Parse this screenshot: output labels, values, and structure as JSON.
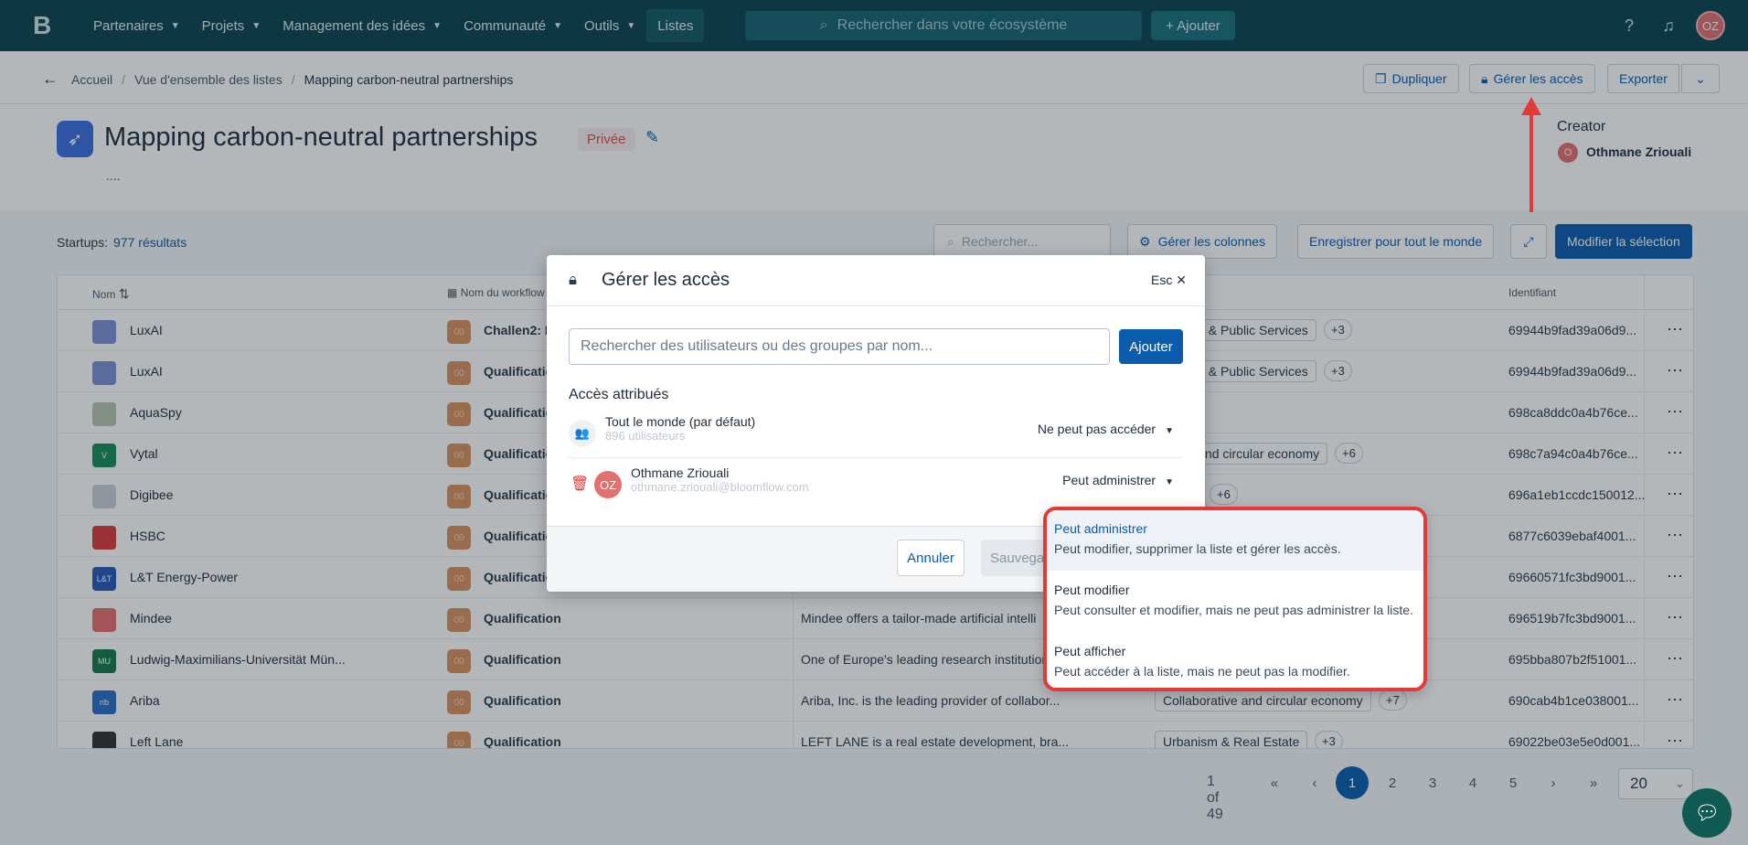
{
  "topnav": {
    "logo": "B",
    "items": [
      {
        "label": "Partenaires",
        "has_menu": true
      },
      {
        "label": "Projets",
        "has_menu": true
      },
      {
        "label": "Management des idées",
        "has_menu": true
      },
      {
        "label": "Communauté",
        "has_menu": true
      },
      {
        "label": "Outils",
        "has_menu": true
      },
      {
        "label": "Listes",
        "has_menu": false
      }
    ],
    "search_placeholder": "Rechercher dans votre écosystème",
    "add_label": "+ Ajouter",
    "avatar": "OZ"
  },
  "breadcrumb": {
    "items": [
      "Accueil",
      "Vue d'ensemble des listes",
      "Mapping carbon-neutral partnerships"
    ]
  },
  "header_actions": {
    "duplicate": "Dupliquer",
    "manage_access": "Gérer les accès",
    "export": "Exporter"
  },
  "page": {
    "title": "Mapping carbon-neutral partnerships",
    "visibility": "Privée",
    "description": "....",
    "creator_label": "Creator",
    "creator_avatar": "O",
    "creator_name": "Othmane Zriouali"
  },
  "toolbar": {
    "startups_label": "Startups:",
    "results": "977 résultats",
    "search_placeholder": "Rechercher...",
    "manage_columns": "Gérer les colonnes",
    "save_for_all": "Enregistrer pour tout le monde",
    "modify_selection": "Modifier la sélection"
  },
  "table": {
    "columns": {
      "name": "Nom",
      "workflow": "Nom du workflow",
      "identifier": "Identifiant"
    },
    "rows": [
      {
        "name": "LuxAI",
        "workflow": "Challen2: P",
        "desc": "",
        "tag": "stration & Public Services",
        "more": "+3",
        "id": "69944b9fad39a06d9...",
        "logo": "",
        "color": "#7c8fd6"
      },
      {
        "name": "LuxAI",
        "workflow": "Qualification",
        "desc": "",
        "tag": "stration & Public Services",
        "more": "+3",
        "id": "69944b9fad39a06d9...",
        "logo": "",
        "color": "#7c8fd6"
      },
      {
        "name": "AquaSpy",
        "workflow": "Qualification",
        "desc": "",
        "tag": "",
        "more": "",
        "id": "698ca8ddc0a4b76ce...",
        "logo": "",
        "color": "#b8c3b0"
      },
      {
        "name": "Vytal",
        "workflow": "Qualification",
        "desc": "",
        "tag": "rative and circular economy",
        "more": "+6",
        "id": "698c7a94c0a4b76ce...",
        "logo": "V",
        "color": "#1b8c5a"
      },
      {
        "name": "Digibee",
        "workflow": "Qualification",
        "desc": "",
        "tag": "",
        "more": "+6",
        "id": "696a1eb1ccdc150012...",
        "logo": "",
        "color": "#c9ced8"
      },
      {
        "name": "HSBC",
        "workflow": "Qualification",
        "desc": "",
        "tag": "",
        "more": "",
        "id": "6877c6039ebaf4001...",
        "logo": "",
        "color": "#d93b3b"
      },
      {
        "name": "L&T Energy-Power",
        "workflow": "Qualification",
        "desc": "",
        "tag": "",
        "more": "",
        "id": "69660571fc3bd9001...",
        "logo": "L&T",
        "color": "#2a57b8"
      },
      {
        "name": "Mindee",
        "workflow": "Qualification",
        "desc": "Mindee offers a tailor-made artificial intelli",
        "tag": "",
        "more": "",
        "id": "696519b7fc3bd9001...",
        "logo": "",
        "color": "#e86d6d"
      },
      {
        "name": "Ludwig-Maximilians-Universität Mün...",
        "workflow": "Qualification",
        "desc": "One of Europe's leading research institution",
        "tag": "",
        "more": "",
        "id": "695bba807b2f51001...",
        "logo": "MU",
        "color": "#167a4a"
      },
      {
        "name": "Ariba",
        "workflow": "Qualification",
        "desc": "Ariba, Inc. is the leading provider of collabor...",
        "tag": "Collaborative and circular economy",
        "more": "+7",
        "id": "690cab4b1ce038001...",
        "logo": "rib",
        "color": "#2a6fc6"
      },
      {
        "name": "Left Lane",
        "workflow": "Qualification",
        "desc": "LEFT LANE is a real estate development, bra...",
        "tag": "Urbanism & Real Estate",
        "more": "+3",
        "id": "69022be03e5e0d001...",
        "logo": "",
        "color": "#333333"
      }
    ]
  },
  "pagination": {
    "summary": "1 of 49",
    "pages": [
      "1",
      "2",
      "3",
      "4",
      "5"
    ],
    "current": "1",
    "page_size": "20"
  },
  "modal": {
    "title": "Gérer les accès",
    "esc_label": "Esc",
    "search_placeholder": "Rechercher des utilisateurs ou des groupes par nom...",
    "add_label": "Ajouter",
    "section_label": "Accès attribués",
    "entries": [
      {
        "name": "Tout le monde (par défaut)",
        "sub": "896 utilisateurs",
        "role": "Ne peut pas accéder",
        "avatar": "👥"
      },
      {
        "name": "Othmane Zriouali",
        "sub": "othmane.zriouali@bloomflow.com",
        "role": "Peut administrer",
        "avatar": "OZ"
      }
    ],
    "cancel_label": "Annuler",
    "save_label": "Sauvegarder"
  },
  "role_dropdown": {
    "options": [
      {
        "title": "Peut administrer",
        "desc": "Peut modifier, supprimer la liste et gérer les accès.",
        "selected": true
      },
      {
        "title": "Peut modifier",
        "desc": "Peut consulter et modifier, mais ne peut pas administrer la liste.",
        "selected": false
      },
      {
        "title": "Peut afficher",
        "desc": "Peut accéder à la liste, mais ne peut pas la modifier.",
        "selected": false
      }
    ]
  },
  "colors": {
    "nav_bg": "#0b4450",
    "primary": "#0b5cad",
    "annotation": "#e53935"
  }
}
